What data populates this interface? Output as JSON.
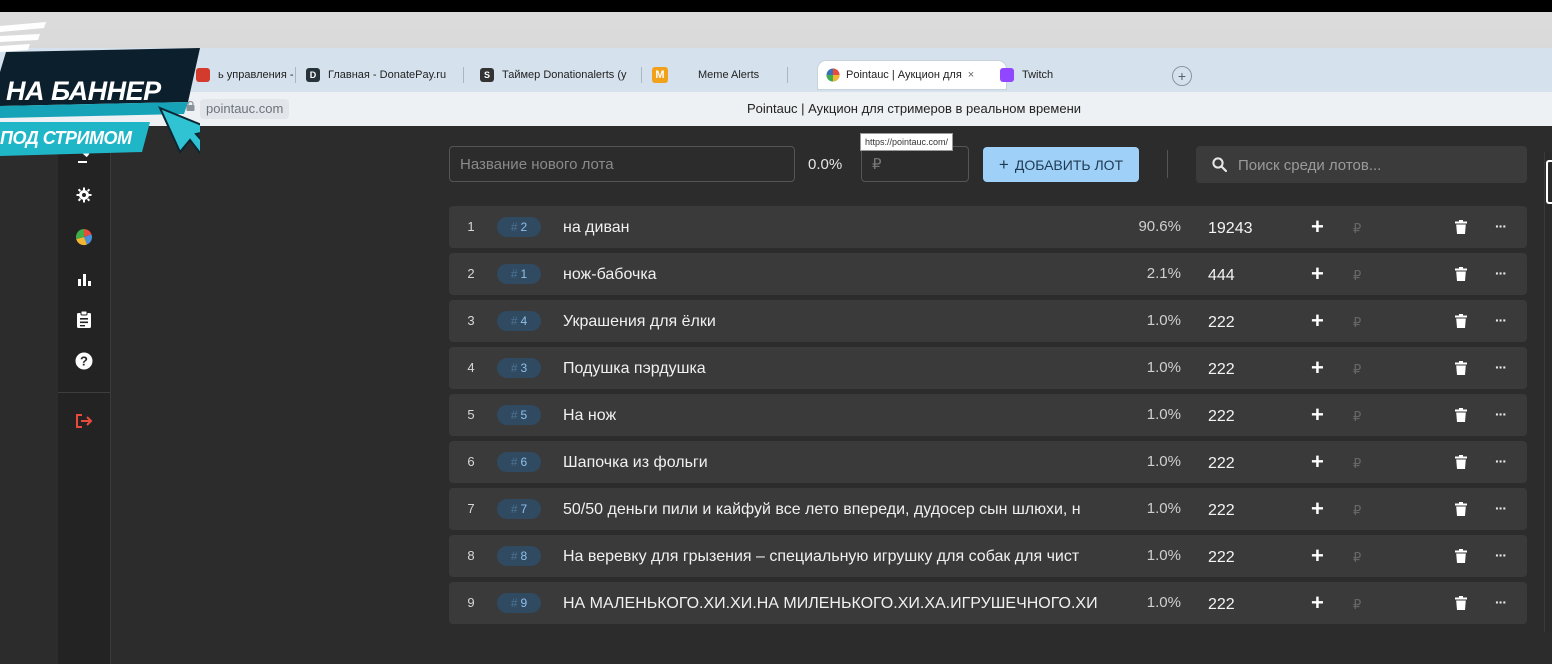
{
  "overlay": {
    "banner_line1": "НА БАННЕР",
    "banner_line2": "ПОД СТРИМОМ"
  },
  "browser": {
    "tabs": [
      {
        "label": "ь управления - Do",
        "favicon_color": "#d33b2c"
      },
      {
        "label": "Главная - DonatePay.ru",
        "favicon_color": "#27333a",
        "favicon_text": "D"
      },
      {
        "label": "Таймер Donationalerts (y",
        "favicon_color": "#333333",
        "favicon_text": "S"
      },
      {
        "label": "M",
        "favicon_color": "#f2a11b"
      },
      {
        "label": "Meme Alerts"
      },
      {
        "label": "Pointauc | Аукцион для",
        "active": true
      },
      {
        "label": "Twitch",
        "favicon_color": "#9146ff"
      }
    ],
    "close_tab_label": "×",
    "new_tab_label": "+",
    "url": "pointauc.com",
    "page_title": "Pointauc | Аукцион для стримеров в реальном времени",
    "url_tooltip": "https://pointauc.com/"
  },
  "toolbar": {
    "lot_name_placeholder": "Название нового лота",
    "new_lot_percent": "0.0%",
    "amount_placeholder": "₽",
    "add_lot_label": "ДОБАВИТЬ ЛОТ",
    "add_lot_plus": "+",
    "search_placeholder": "Поиск среди лотов...",
    "accent_color": "#9fd0f7"
  },
  "sidebar": {
    "icons": [
      "auction-icon",
      "gear-icon",
      "pie-chart-icon",
      "bar-chart-icon",
      "clipboard-icon",
      "help-icon",
      "logout-icon"
    ]
  },
  "lots": [
    {
      "rank": "1",
      "id": "2",
      "name": "на диван",
      "percent": "90.6%",
      "amount": "19243"
    },
    {
      "rank": "2",
      "id": "1",
      "name": "нож-бабочка",
      "percent": "2.1%",
      "amount": "444"
    },
    {
      "rank": "3",
      "id": "4",
      "name": "Украшения для ёлки",
      "percent": "1.0%",
      "amount": "222"
    },
    {
      "rank": "4",
      "id": "3",
      "name": "Подушка пэрдушка",
      "percent": "1.0%",
      "amount": "222"
    },
    {
      "rank": "5",
      "id": "5",
      "name": "На нож",
      "percent": "1.0%",
      "amount": "222"
    },
    {
      "rank": "6",
      "id": "6",
      "name": "Шапочка из фольги",
      "percent": "1.0%",
      "amount": "222"
    },
    {
      "rank": "7",
      "id": "7",
      "name": "50/50 деньги пили и кайфуй все лето впереди, дудосер сын шлюхи, н",
      "percent": "1.0%",
      "amount": "222"
    },
    {
      "rank": "8",
      "id": "8",
      "name": "На веревку для грызения – специальную игрушку для собак для чист",
      "percent": "1.0%",
      "amount": "222"
    },
    {
      "rank": "9",
      "id": "9",
      "name": "НА МАЛЕНЬКОГО.ХИ.ХИ.НА МИЛЕНЬКОГО.ХИ.ХА.ИГРУШЕЧНОГО.ХИ",
      "percent": "1.0%",
      "amount": "222"
    }
  ],
  "lot_labels": {
    "hash": "#",
    "plus": "+",
    "ruble": "₽",
    "menu": "···"
  }
}
